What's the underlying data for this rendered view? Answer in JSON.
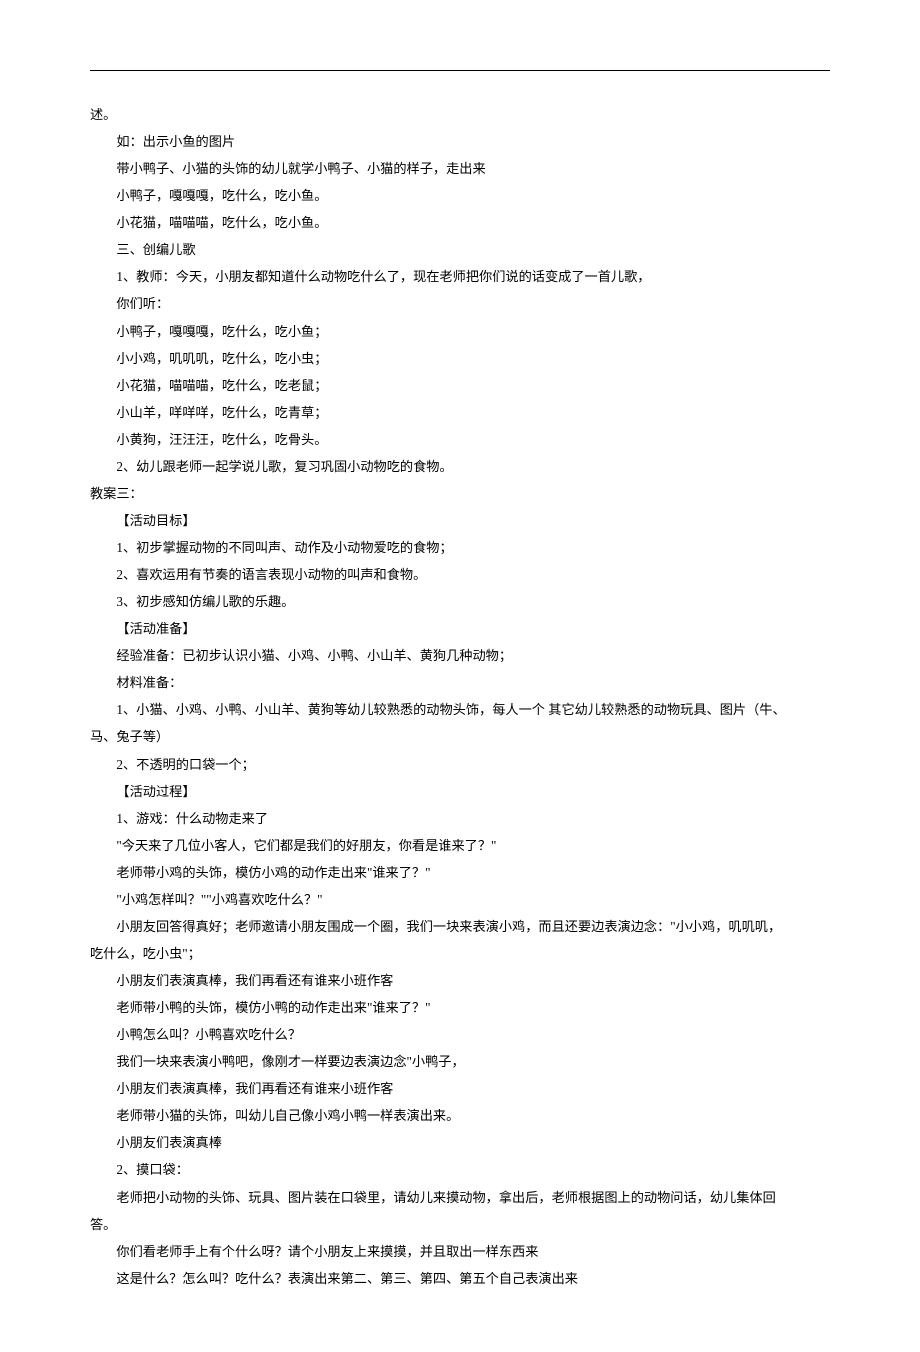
{
  "lines": [
    {
      "cls": "flush",
      "text": "述。"
    },
    {
      "cls": "ind1",
      "text": "如：出示小鱼的图片"
    },
    {
      "cls": "ind1",
      "text": "带小鸭子、小猫的头饰的幼儿就学小鸭子、小猫的样子，走出来"
    },
    {
      "cls": "ind1",
      "text": "小鸭子，嘎嘎嘎，吃什么，吃小鱼。"
    },
    {
      "cls": "ind1",
      "text": "小花猫，喵喵喵，吃什么，吃小鱼。"
    },
    {
      "cls": "ind1",
      "text": "三、创编儿歌"
    },
    {
      "cls": "ind1",
      "text": "1、教师：今天，小朋友都知道什么动物吃什么了，现在老师把你们说的话变成了一首儿歌，"
    },
    {
      "cls": "ind1",
      "text": "你们听："
    },
    {
      "cls": "ind1",
      "text": "小鸭子，嘎嘎嘎，吃什么，吃小鱼；"
    },
    {
      "cls": "ind1",
      "text": "小小鸡，叽叽叽，吃什么，吃小虫；"
    },
    {
      "cls": "ind1",
      "text": "小花猫，喵喵喵，吃什么，吃老鼠；"
    },
    {
      "cls": "ind1",
      "text": "小山羊，咩咩咩，吃什么，吃青草；"
    },
    {
      "cls": "ind1",
      "text": "小黄狗，汪汪汪，吃什么，吃骨头。"
    },
    {
      "cls": "ind1",
      "text": "2、幼儿跟老师一起学说儿歌，复习巩固小动物吃的食物。"
    },
    {
      "cls": "flush",
      "text": "教案三："
    },
    {
      "cls": "ind1",
      "text": "【活动目标】"
    },
    {
      "cls": "ind1",
      "text": "1、初步掌握动物的不同叫声、动作及小动物爱吃的食物；"
    },
    {
      "cls": "ind1",
      "text": "2、喜欢运用有节奏的语言表现小动物的叫声和食物。"
    },
    {
      "cls": "ind1",
      "text": "3、初步感知仿编儿歌的乐趣。"
    },
    {
      "cls": "ind1",
      "text": "【活动准备】"
    },
    {
      "cls": "ind1",
      "text": "经验准备：已初步认识小猫、小鸡、小鸭、小山羊、黄狗几种动物；"
    },
    {
      "cls": "ind1",
      "text": "材料准备："
    },
    {
      "cls": "ind1",
      "text": "1、小猫、小鸡、小鸭、小山羊、黄狗等幼儿较熟悉的动物头饰，每人一个 其它幼儿较熟悉的动物玩具、图片（牛、"
    },
    {
      "cls": "flush",
      "text": "马、兔子等）"
    },
    {
      "cls": "ind1",
      "text": "2、不透明的口袋一个；"
    },
    {
      "cls": "ind1",
      "text": "【活动过程】"
    },
    {
      "cls": "ind1",
      "text": "1、游戏：什么动物走来了"
    },
    {
      "cls": "ind1",
      "text": "\"今天来了几位小客人，它们都是我们的好朋友，你看是谁来了？\""
    },
    {
      "cls": "ind1",
      "text": "老师带小鸡的头饰，模仿小鸡的动作走出来\"谁来了？\""
    },
    {
      "cls": "ind1",
      "text": "\"小鸡怎样叫？\"\"小鸡喜欢吃什么？\""
    },
    {
      "cls": "ind1",
      "text": "小朋友回答得真好；老师邀请小朋友围成一个圈，我们一块来表演小鸡，而且还要边表演边念：\"小小鸡，叽叽叽，"
    },
    {
      "cls": "flush",
      "text": "吃什么，吃小虫\"；"
    },
    {
      "cls": "ind1",
      "text": "小朋友们表演真棒，我们再看还有谁来小班作客"
    },
    {
      "cls": "ind1",
      "text": "老师带小鸭的头饰，模仿小鸭的动作走出来\"谁来了？\""
    },
    {
      "cls": "ind1",
      "text": "小鸭怎么叫？小鸭喜欢吃什么？"
    },
    {
      "cls": "ind1",
      "text": "我们一块来表演小鸭吧，像刚才一样要边表演边念\"小鸭子，"
    },
    {
      "cls": "ind1",
      "text": "小朋友们表演真棒，我们再看还有谁来小班作客"
    },
    {
      "cls": "ind1",
      "text": "老师带小猫的头饰，叫幼儿自己像小鸡小鸭一样表演出来。"
    },
    {
      "cls": "ind1",
      "text": "小朋友们表演真棒"
    },
    {
      "cls": "ind1",
      "text": "2、摸口袋："
    },
    {
      "cls": "ind1",
      "text": "老师把小动物的头饰、玩具、图片装在口袋里，请幼儿来摸动物，拿出后，老师根据图上的动物问话，幼儿集体回"
    },
    {
      "cls": "flush",
      "text": "答。"
    },
    {
      "cls": "ind1",
      "text": "你们看老师手上有个什么呀？请个小朋友上来摸摸，并且取出一样东西来"
    },
    {
      "cls": "ind1",
      "text": "这是什么？怎么叫？吃什么？表演出来第二、第三、第四、第五个自己表演出来"
    }
  ]
}
